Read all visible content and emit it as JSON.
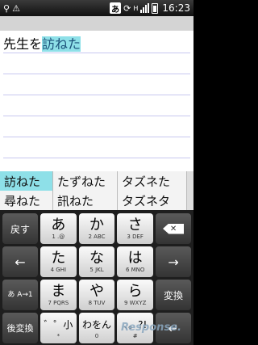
{
  "status_bar": {
    "left_icons": [
      "usb-icon",
      "warning-icon"
    ],
    "ime_indicator": "あ",
    "time": "16:23",
    "network_label": "H"
  },
  "editor": {
    "text_plain": "先生を",
    "text_composing": "訪ねた"
  },
  "candidates": {
    "items": [
      "訪ねた",
      "たずねた",
      "タズネた",
      "尋ねた",
      "訊ねた",
      "タズネタ"
    ],
    "selected": 0
  },
  "keyboard": {
    "rows": [
      {
        "left": "戻す",
        "keys": [
          {
            "label": "あ",
            "sub": "1 .@"
          },
          {
            "label": "か",
            "sub": "2 ABC"
          },
          {
            "label": "さ",
            "sub": "3 DEF"
          }
        ],
        "right": "⌫"
      },
      {
        "left": "←",
        "keys": [
          {
            "label": "た",
            "sub": "4 GHI"
          },
          {
            "label": "な",
            "sub": "5 JKL"
          },
          {
            "label": "は",
            "sub": "6 MNO"
          }
        ],
        "right": "→"
      },
      {
        "left": "あ A→1",
        "keys": [
          {
            "label": "ま",
            "sub": "7 PQRS"
          },
          {
            "label": "や",
            "sub": "8 TUV"
          },
          {
            "label": "ら",
            "sub": "9 WXYZ"
          }
        ],
        "right": "変換"
      },
      {
        "left": "後変換",
        "keys": [
          {
            "label": "゛゜小",
            "sub": "*"
          },
          {
            "label": "わをん",
            "sub": "0"
          },
          {
            "label": "、。?!",
            "sub": "#"
          }
        ],
        "right": "↵"
      }
    ]
  },
  "watermark": "Response."
}
